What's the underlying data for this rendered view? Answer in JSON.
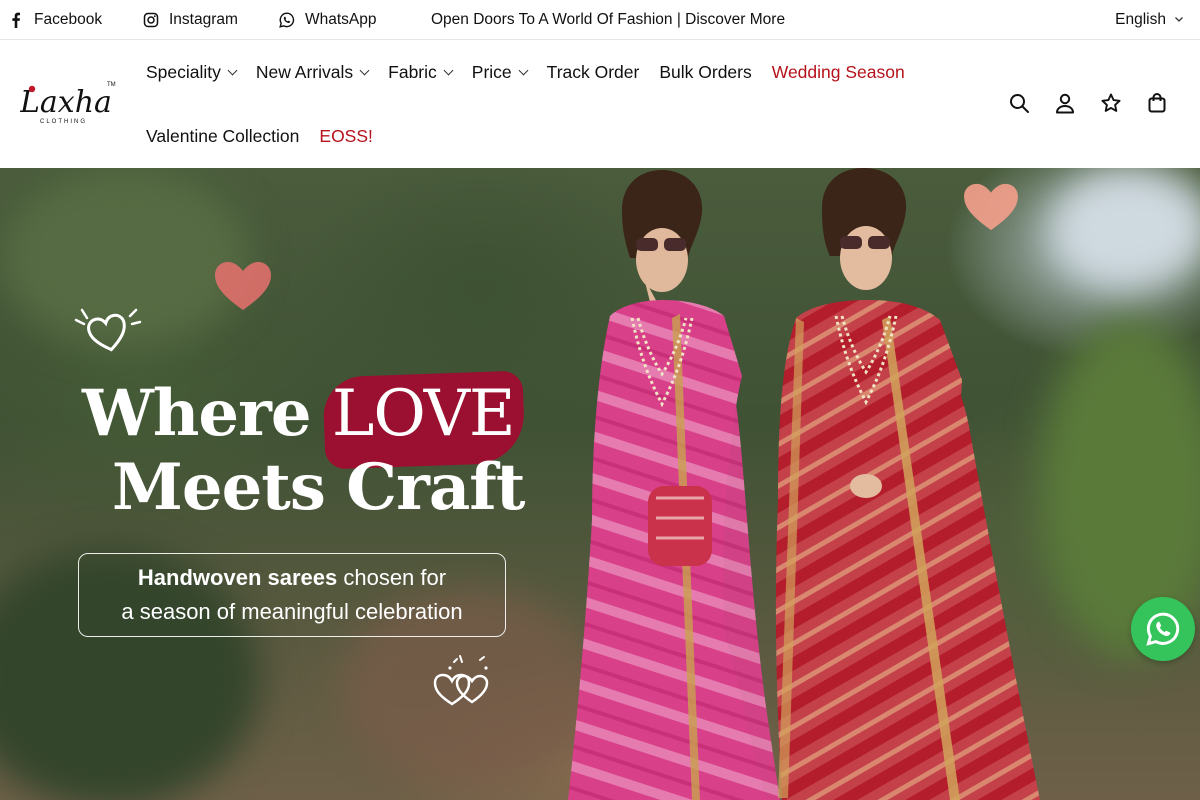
{
  "topbar": {
    "social": [
      {
        "label": "Facebook",
        "icon": "facebook-icon"
      },
      {
        "label": "Instagram",
        "icon": "instagram-icon"
      },
      {
        "label": "WhatsApp",
        "icon": "whatsapp-icon"
      }
    ],
    "promo_text": "Open Doors To A World Of Fashion | Discover More",
    "language": "English"
  },
  "brand": {
    "logo_text": "Laxha",
    "logo_sub": "CLOTHING",
    "logo_tm": "TM"
  },
  "nav": {
    "row1": [
      {
        "label": "Speciality",
        "dropdown": true,
        "highlight": false
      },
      {
        "label": "New Arrivals",
        "dropdown": true,
        "highlight": false
      },
      {
        "label": "Fabric",
        "dropdown": true,
        "highlight": false
      },
      {
        "label": "Price",
        "dropdown": true,
        "highlight": false
      },
      {
        "label": "Track Order",
        "dropdown": false,
        "highlight": false
      },
      {
        "label": "Bulk Orders",
        "dropdown": false,
        "highlight": false
      },
      {
        "label": "Wedding Season",
        "dropdown": false,
        "highlight": true
      }
    ],
    "row2": [
      {
        "label": "Valentine Collection",
        "dropdown": false,
        "highlight": false
      },
      {
        "label": "EOSS!",
        "dropdown": false,
        "highlight": true
      }
    ]
  },
  "header_icons": [
    "search-icon",
    "account-icon",
    "wishlist-star-icon",
    "cart-bag-icon"
  ],
  "hero": {
    "title_part1": "Where",
    "title_highlight": "LOVE",
    "title_line2": "Meets Craft",
    "subtitle_bold": "Handwoven sarees",
    "subtitle_rest1": " chosen for",
    "subtitle_line2": "a season of meaningful celebration"
  },
  "colors": {
    "accent_red": "#b5121b",
    "love_highlight": "#9b1030",
    "whatsapp_green": "#35c45c",
    "saree_pink": "#d23a7a",
    "saree_red": "#b8202a"
  }
}
